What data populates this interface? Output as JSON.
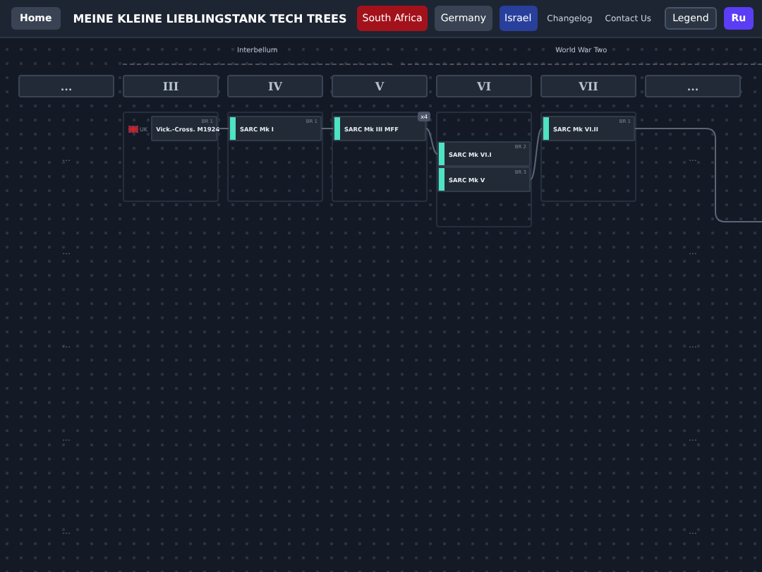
{
  "header": {
    "home": "Home",
    "title": "MEINE KLEINE LIEBLINGSTANK TECH TREES",
    "nations": [
      {
        "label": "South Africa",
        "color": "#a3121b"
      },
      {
        "label": "Germany",
        "color": "#3a4354"
      },
      {
        "label": "Israel",
        "color": "#283f9c"
      }
    ],
    "links": [
      "Changelog",
      "Contact Us"
    ],
    "legend": "Legend",
    "language": "Ru"
  },
  "eras": [
    {
      "label": "Interbellum"
    },
    {
      "label": "World War Two"
    }
  ],
  "columns": [
    {
      "tier": "...",
      "cells": [
        {
          "kind": "more",
          "text": "..."
        },
        {
          "kind": "more",
          "text": "..."
        },
        {
          "kind": "more",
          "text": "..."
        },
        {
          "kind": "more",
          "text": "..."
        },
        {
          "kind": "more",
          "text": "..."
        }
      ]
    },
    {
      "tier": "III",
      "cells": [
        {
          "kind": "group",
          "nodes": [
            {
              "name": "Vick.-Cross. M1924",
              "branch": "BR 1",
              "origin": "UK",
              "kind": "foreign"
            }
          ]
        }
      ]
    },
    {
      "tier": "IV",
      "cells": [
        {
          "kind": "group",
          "nodes": [
            {
              "name": "SARC Mk I",
              "branch": "BR 1",
              "kind": "native"
            }
          ]
        }
      ]
    },
    {
      "tier": "V",
      "cells": [
        {
          "kind": "group",
          "nodes": [
            {
              "name": "SARC Mk III MFF",
              "branch": "x4",
              "kind": "native"
            }
          ]
        }
      ]
    },
    {
      "tier": "VI",
      "cells": [
        {
          "kind": "branch-group",
          "nodes": [
            {
              "name": "SARC Mk VI.I",
              "branch": "BR 2",
              "kind": "native"
            },
            {
              "name": "SARC Mk V",
              "branch": "BR 3",
              "kind": "native"
            }
          ]
        }
      ]
    },
    {
      "tier": "VII",
      "cells": [
        {
          "kind": "group",
          "nodes": [
            {
              "name": "SARC Mk VI.II",
              "branch": "BR 1",
              "kind": "native"
            }
          ]
        }
      ]
    },
    {
      "tier": "...",
      "cells": [
        {
          "kind": "more",
          "text": "..."
        },
        {
          "kind": "more",
          "text": "..."
        },
        {
          "kind": "more",
          "text": "..."
        },
        {
          "kind": "more",
          "text": "..."
        },
        {
          "kind": "more",
          "text": "..."
        }
      ]
    }
  ]
}
